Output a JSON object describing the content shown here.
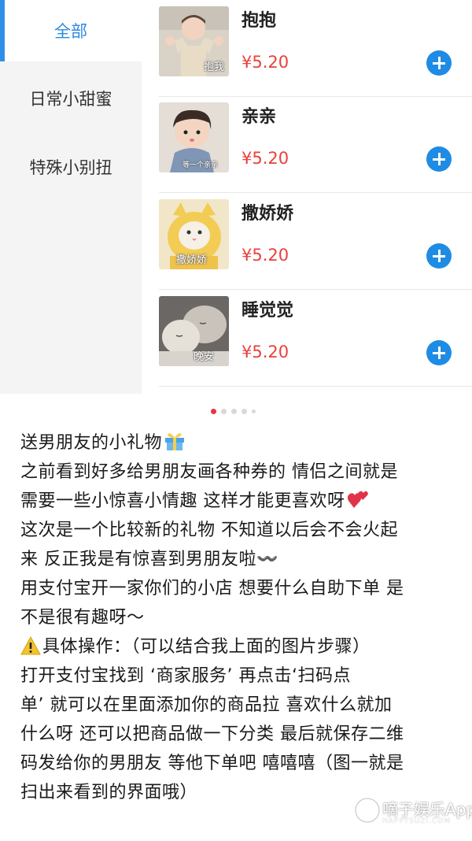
{
  "sidebar": {
    "categories": [
      {
        "label": "全部",
        "active": true
      },
      {
        "label": "日常小甜蜜",
        "active": false
      },
      {
        "label": "特殊小别扭",
        "active": false
      }
    ]
  },
  "products": [
    {
      "name": "抱抱",
      "price": "¥5.20",
      "thumb_caption": "抱我",
      "icon": "toddler-hug-photo"
    },
    {
      "name": "亲亲",
      "price": "¥5.20",
      "thumb_caption": "等一个亲亲",
      "icon": "toddler-kiss-photo"
    },
    {
      "name": "撒娇娇",
      "price": "¥5.20",
      "thumb_caption": "撒娇娇",
      "icon": "cat-costume-photo"
    },
    {
      "name": "睡觉觉",
      "price": "¥5.20",
      "thumb_caption": "晚安",
      "icon": "sleeping-cats-photo"
    }
  ],
  "carousel": {
    "count": 5,
    "active_index": 0
  },
  "post": {
    "lines": [
      "送男朋友的小礼物",
      "之前看到好多给男朋友画各种券的 情侣之间就是",
      "需要一些小惊喜小情趣 这样才能更喜欢呀",
      "这次是一个比较新的礼物 不知道以后会不会火起",
      "来 反正我是有惊喜到男朋友啦〰️",
      "用支付宝开一家你们的小店 想要什么自助下单 是",
      "不是很有趣呀～",
      "具体操作：（可以结合我上面的图片步骤）",
      "打开支付宝找到 ‘商家服务’  再点击‘扫码点",
      "单’ 就可以在里面添加你的商品拉 喜欢什么就加",
      "什么呀 还可以把商品做一下分类 最后就保存二维",
      "码发给你的男朋友 等他下单吧 嘻嘻嘻（图一就是",
      "扫出来看到的界面哦）"
    ]
  },
  "watermark": {
    "text": "嘀子娱乐App",
    "url": "HAPPYSUZI.COM"
  },
  "colors": {
    "accent": "#2f8fe6",
    "price": "#e9403c",
    "active_dot": "#e8344a"
  }
}
